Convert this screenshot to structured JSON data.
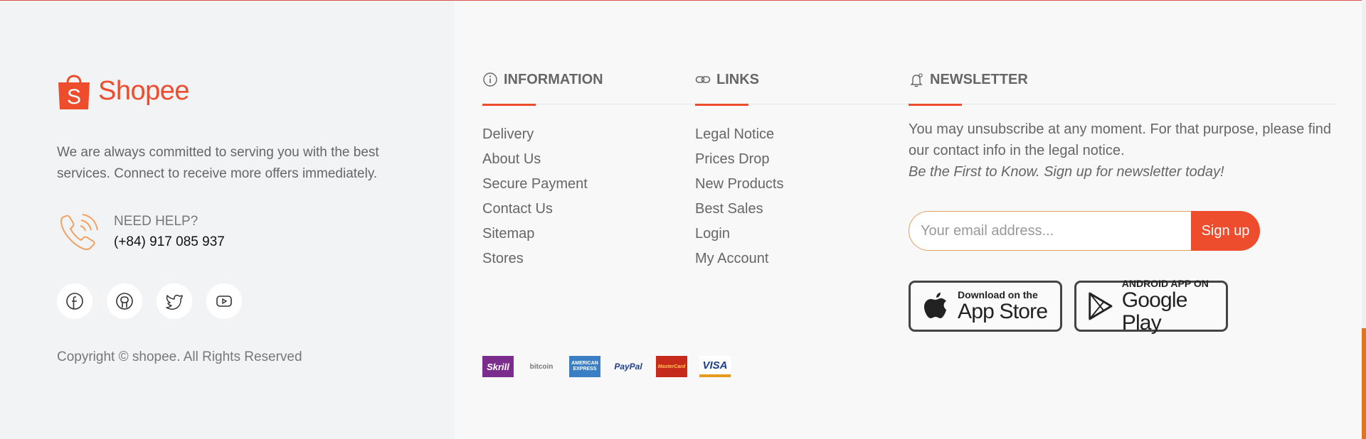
{
  "brand": {
    "name": "Shopee",
    "logo_letter": "S",
    "color": "#ee4d2d"
  },
  "about": "We are always committed to serving you with the best services. Connect to receive more offers immediately.",
  "help": {
    "label": "NEED HELP?",
    "phone": "(+84) 917 085 937"
  },
  "socials": [
    "facebook-icon",
    "github-icon",
    "twitter-icon",
    "youtube-icon"
  ],
  "copyright": "Copyright © shopee. All Rights Reserved",
  "information": {
    "title": "INFORMATION",
    "items": [
      "Delivery",
      "About Us",
      "Secure Payment",
      "Contact Us",
      "Sitemap",
      "Stores"
    ]
  },
  "links": {
    "title": "LINKS",
    "items": [
      "Legal Notice",
      "Prices Drop",
      "New Products",
      "Best Sales",
      "Login",
      "My Account"
    ]
  },
  "newsletter": {
    "title": "NEWSLETTER",
    "text": "You may unsubscribe at any moment. For that purpose, please find our contact info in the legal notice.",
    "tagline": "Be the First to Know. Sign up for newsletter today!",
    "placeholder": "Your email address...",
    "button": "Sign up"
  },
  "apps": {
    "appstore": {
      "small": "Download on the",
      "big": "App Store"
    },
    "googleplay": {
      "small": "ANDROID APP ON",
      "big": "Google Play"
    }
  },
  "payments": [
    "Skrill",
    "bitcoin",
    "AMERICAN EXPRESS",
    "PayPal",
    "MasterCard",
    "VISA"
  ]
}
